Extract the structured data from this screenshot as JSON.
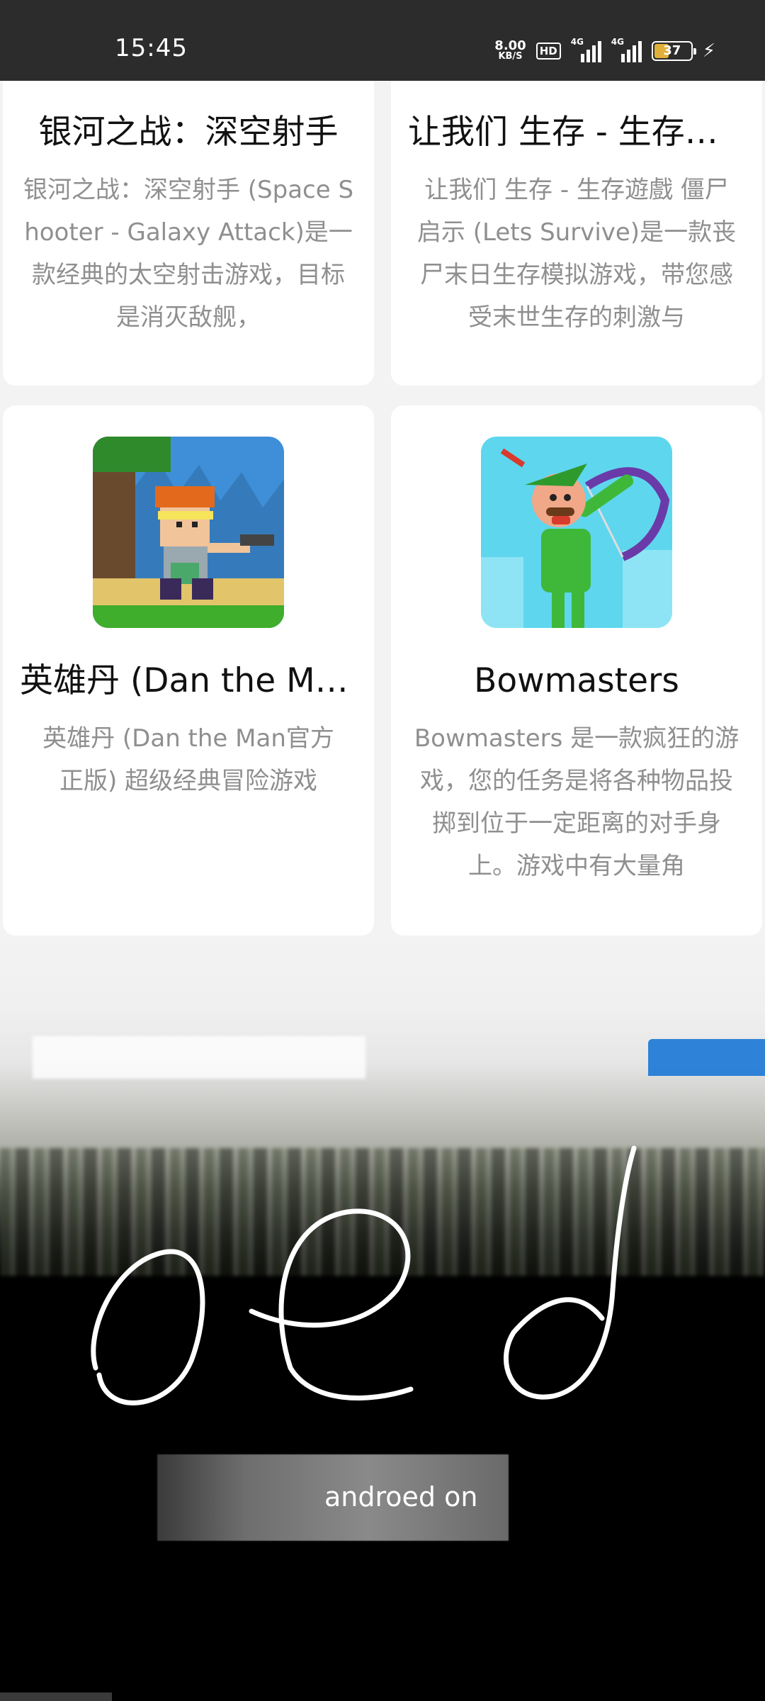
{
  "status_bar": {
    "time": "15:45",
    "net_speed": "8.00",
    "net_unit": "KB/S",
    "hd": "HD",
    "signal1": "4G",
    "signal2": "4G",
    "battery": "37"
  },
  "cards": [
    {
      "title": "银河之战：深空射手",
      "desc": "银河之战：深空射手 (Space Shooter - Galaxy Attack)是一款经典的太空射击游戏，目标是消灭敌舰，"
    },
    {
      "title": "让我们 生存 - 生存遊戲 僵尸 启示",
      "desc": "让我们 生存 - 生存遊戲 僵尸 启示 (Lets Survive)是一款丧尸末日生存模拟游戏，带您感受末世生存的刺激与"
    },
    {
      "title": "英雄丹 (Dan the Man官方正版)",
      "desc": "英雄丹 (Dan the Man官方正版) 超级经典冒险游戏",
      "icon": "dan-the-man-icon"
    },
    {
      "title": "Bowmasters",
      "desc": "Bowmasters 是一款疯狂的游戏，您的任务是将各种物品投掷到位于一定距离的对手身上。游戏中有大量角",
      "icon": "bowmasters-icon"
    }
  ],
  "overlay": {
    "brand_text": "androed on"
  }
}
